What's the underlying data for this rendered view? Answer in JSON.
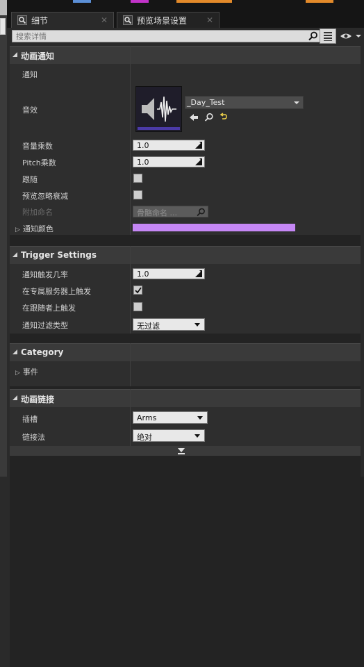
{
  "top_strip_colors": [
    "#5b8fd6",
    "#c233c9",
    "#e38a2a",
    "#e38a2a"
  ],
  "tabs": [
    {
      "label": "细节",
      "icon": "details-search-icon"
    },
    {
      "label": "预览场景设置",
      "icon": "scene-search-icon"
    }
  ],
  "search": {
    "placeholder": "搜索详情"
  },
  "sections": {
    "anim_notify": {
      "title": "动画通知",
      "rows": {
        "notify": "通知",
        "sound": "音效",
        "volume_multiplier": "音量乘数",
        "pitch_multiplier": "Pitch乘数",
        "follow": "跟随",
        "preview_ignore_attenuation": "预览忽略衰减",
        "attach_name": "附加命名",
        "notify_color": "通知颜色"
      },
      "sound_asset": "_Day_Test",
      "volume_value": "1.0",
      "pitch_value": "1.0",
      "attach_placeholder": "骨骼命名 ...",
      "notify_color_hex": "#c587f5"
    },
    "trigger_settings": {
      "title": "Trigger Settings",
      "rows": {
        "trigger_chance": "通知触发几率",
        "trigger_on_dedicated_server": "在专属服务器上触发",
        "trigger_on_follower": "在跟随者上触发",
        "filter_type": "通知过滤类型"
      },
      "trigger_chance_value": "1.0",
      "dedicated_server_checked": true,
      "follower_checked": false,
      "filter_value": "无过滤"
    },
    "category": {
      "title": "Category",
      "rows": {
        "event": "事件"
      }
    },
    "anim_link": {
      "title": "动画链接",
      "rows": {
        "slot": "插槽",
        "link_method": "链接法"
      },
      "slot_value": "Arms",
      "link_method_value": "绝对"
    }
  }
}
